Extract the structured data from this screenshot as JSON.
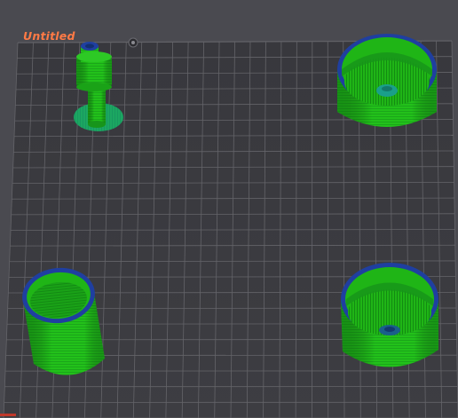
{
  "plate": {
    "name": "Untitled"
  },
  "objects": [
    {
      "id": "object-1",
      "type": "stacked-cylinder"
    },
    {
      "id": "object-2",
      "type": "cup-with-floor"
    },
    {
      "id": "object-3",
      "type": "cup"
    },
    {
      "id": "object-4",
      "type": "cup-with-floor"
    }
  ],
  "theme": {
    "background": "#4a4a50",
    "bed": "#3a3a3f",
    "grid": "#636369",
    "title": "#ff7a45",
    "wall_green": "#22c11a",
    "wall_dark_green": "#1a8f18",
    "rim_blue": "#1f3fa0",
    "brim_teal": "#1a9f8a"
  },
  "icons": {
    "plate_logo": "printer-logo-icon"
  }
}
